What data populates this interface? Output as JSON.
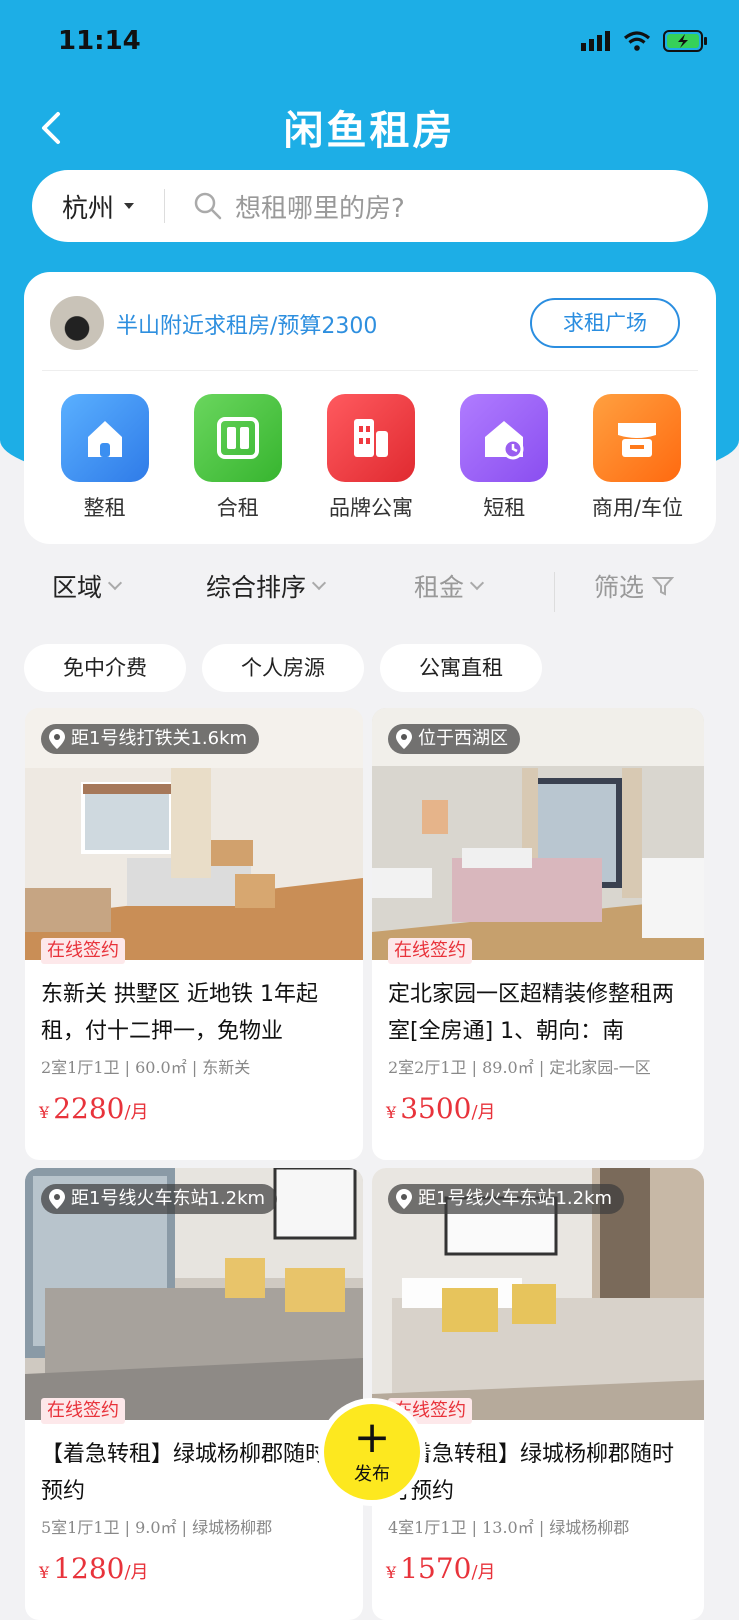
{
  "status_bar": {
    "time": "11:14"
  },
  "header": {
    "title": "闲鱼租房"
  },
  "search": {
    "city": "杭州",
    "placeholder": "想租哪里的房?"
  },
  "request": {
    "text": "半山附近求租房/预算2300",
    "button_label": "求租广场"
  },
  "categories": [
    {
      "label": "整租",
      "color": "#3b8ff1",
      "icon": "house-icon"
    },
    {
      "label": "合租",
      "color": "#43c03c",
      "icon": "shared-room-icon"
    },
    {
      "label": "品牌公寓",
      "color": "#f0393f",
      "icon": "building-icon"
    },
    {
      "label": "短租",
      "color": "#9a5ef0",
      "icon": "clock-house-icon"
    },
    {
      "label": "商用/车位",
      "color": "#ff7a1a",
      "icon": "shop-icon"
    }
  ],
  "filters": {
    "area": "区域",
    "sort": "综合排序",
    "rent": "租金",
    "more": "筛选"
  },
  "chips": [
    "免中介费",
    "个人房源",
    "公寓直租"
  ],
  "listings": [
    {
      "location": "距1号线打铁关1.6km",
      "badge": "在线签约",
      "title": "东新关 拱墅区 近地铁 1年起租，付十二押一，免物业",
      "meta": "2室1厅1卫 | 60.0㎡ | 东新关",
      "currency": "¥",
      "price": "2280",
      "unit": "/月"
    },
    {
      "location": "位于西湖区",
      "badge": "在线签约",
      "title": "定北家园一区超精装修整租两室[全房通] 1、朝向：南",
      "meta": "2室2厅1卫 | 89.0㎡ | 定北家园-一区",
      "currency": "¥",
      "price": "3500",
      "unit": "/月"
    },
    {
      "location": "距1号线火车东站1.2km",
      "badge": "在线签约",
      "title": "【着急转租】绿城杨柳郡随时可预约",
      "meta": "5室1厅1卫 | 9.0㎡ | 绿城杨柳郡",
      "currency": "¥",
      "price": "1280",
      "unit": "/月"
    },
    {
      "location": "距1号线火车东站1.2km",
      "badge": "在线签约",
      "title": "【着急转租】绿城杨柳郡随时可预约",
      "meta": "4室1厅1卫 | 13.0㎡ | 绿城杨柳郡",
      "currency": "¥",
      "price": "1570",
      "unit": "/月"
    }
  ],
  "fab": {
    "label": "发布"
  }
}
